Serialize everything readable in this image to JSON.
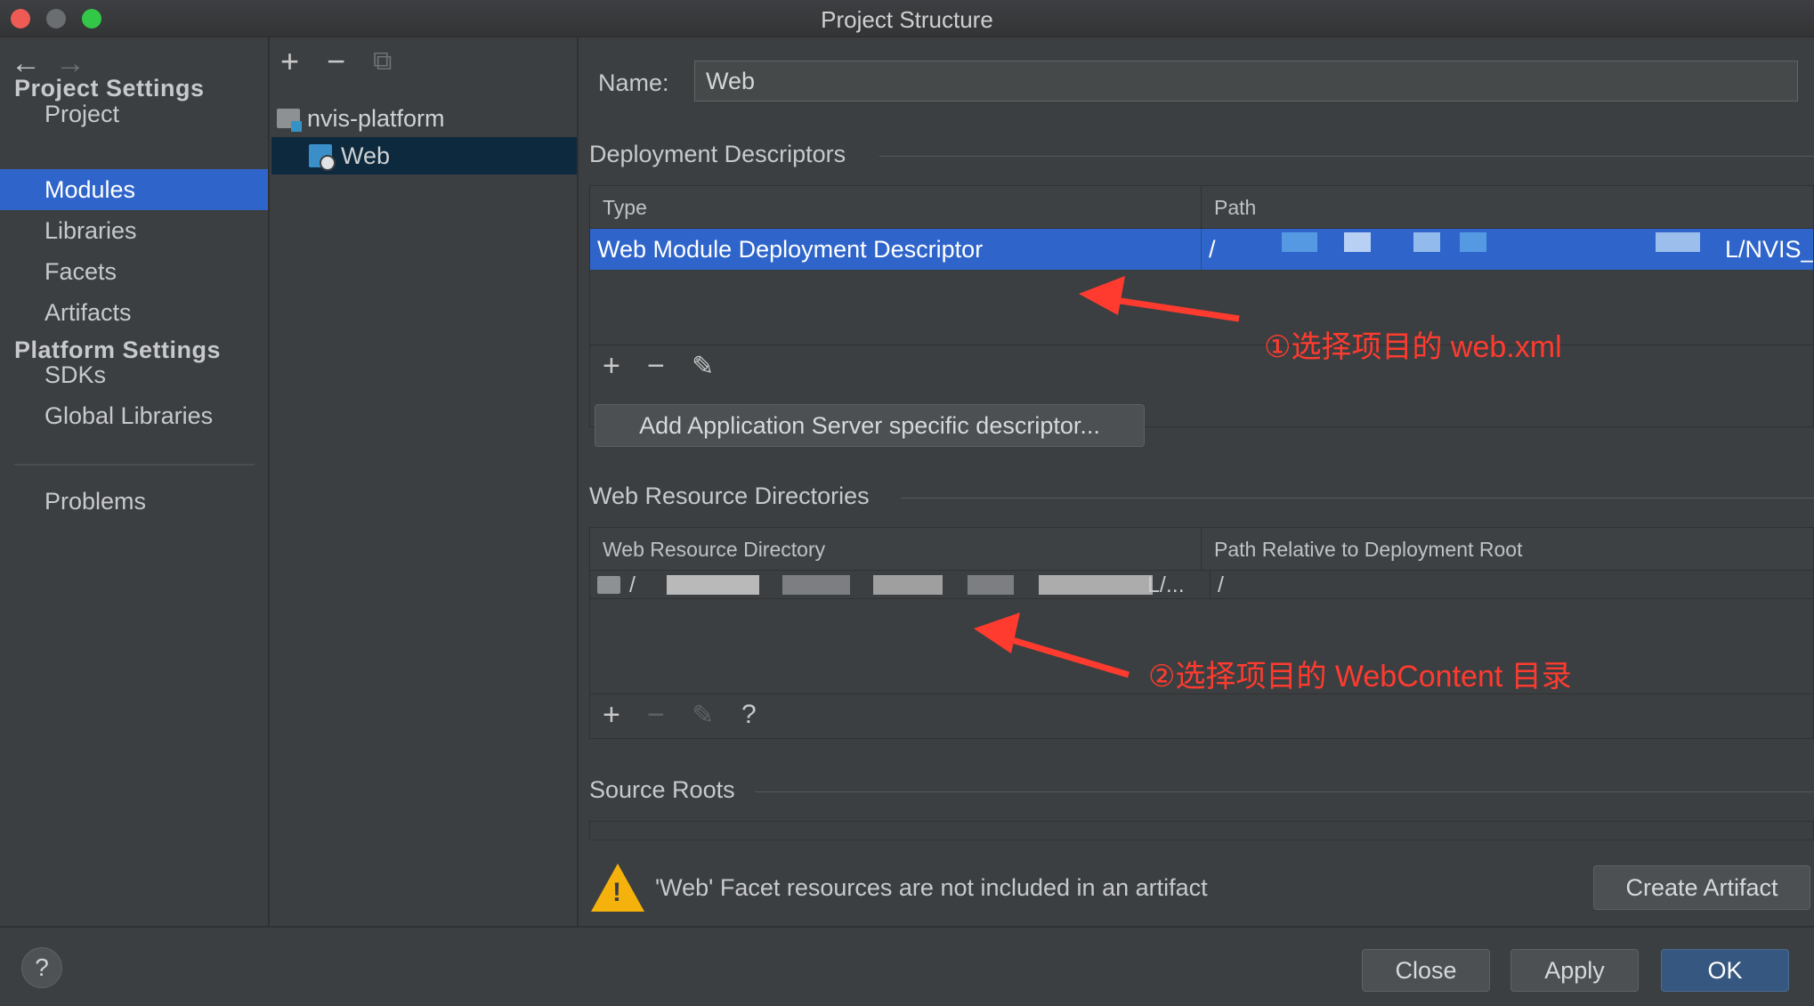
{
  "window": {
    "title": "Project Structure"
  },
  "nav": {
    "back_icon": "←",
    "forward_icon": "→"
  },
  "sidebar": {
    "project_settings_title": "Project Settings",
    "project_items": [
      "Project",
      "Modules",
      "Libraries",
      "Facets",
      "Artifacts"
    ],
    "platform_settings_title": "Platform Settings",
    "platform_items": [
      "SDKs",
      "Global Libraries"
    ],
    "problems": "Problems",
    "active_item": "Modules"
  },
  "tree": {
    "add_icon": "+",
    "remove_icon": "−",
    "copy_icon": "⧉",
    "root": "nvis-platform",
    "child": "Web"
  },
  "facet": {
    "name_label": "Name:",
    "name_value": "Web",
    "deployment": {
      "title": "Deployment Descriptors",
      "col_type": "Type",
      "col_path": "Path",
      "row_type": "Web Module Deployment Descriptor",
      "row_path_prefix": "/",
      "row_path_suffix": "L/NVIS_",
      "add_icon": "+",
      "remove_icon": "−",
      "edit_icon": "✎",
      "add_server_button": "Add Application Server specific descriptor..."
    },
    "web_resources": {
      "title": "Web Resource Directories",
      "col_dir": "Web Resource Directory",
      "col_rel": "Path Relative to Deployment Root",
      "row_dir_prefix": "/",
      "row_dir_suffix": "L/...",
      "row_rel": "/",
      "add_icon": "+",
      "remove_icon": "−",
      "edit_icon": "✎",
      "help_icon": "?"
    },
    "source_roots": {
      "title": "Source Roots"
    },
    "warning": {
      "text": "'Web' Facet resources are not included in an artifact",
      "button": "Create Artifact",
      "icon": "!"
    }
  },
  "annotations": {
    "first": "①选择项目的 web.xml",
    "second": "②选择项目的 WebContent 目录",
    "color": "#ff3b2f"
  },
  "footer": {
    "help": "?",
    "close": "Close",
    "apply": "Apply",
    "ok": "OK"
  },
  "colors": {
    "background": "#3c3f41",
    "selection": "#2f65ca",
    "tree_selection": "#0d293e",
    "primary_button": "#365880",
    "warning": "#f5b20c"
  }
}
